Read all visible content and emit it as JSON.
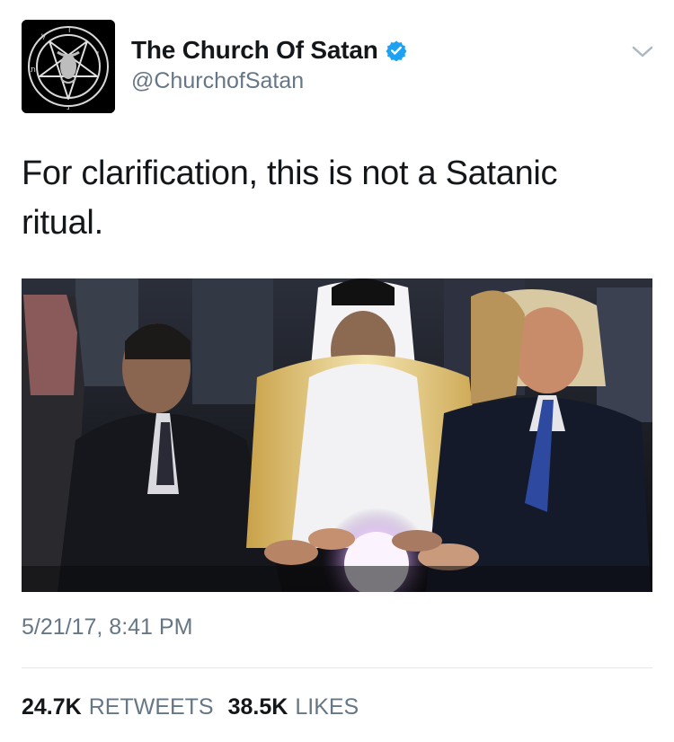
{
  "author": {
    "display_name": "The Church Of Satan",
    "handle": "@ChurchofSatan",
    "verified": true,
    "avatar_icon": "pentagram-sigil-icon"
  },
  "tweet": {
    "text": "For clarification, this is not a Satanic ritual.",
    "media_icon": "photo-glowing-orb",
    "timestamp": "5/21/17, 8:41 PM"
  },
  "stats": {
    "retweets_count": "24.7K",
    "retweets_label": "RETWEETS",
    "likes_count": "38.5K",
    "likes_label": "LIKES"
  },
  "colors": {
    "text_primary": "#14171a",
    "text_secondary": "#657786",
    "verified_blue": "#1da1f2",
    "divider": "#e1e8ed"
  }
}
